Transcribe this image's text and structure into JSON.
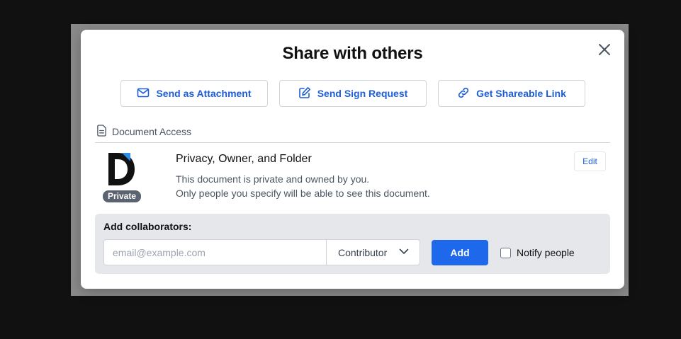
{
  "dialog": {
    "title": "Share with others"
  },
  "actions": {
    "attachment_label": "Send as Attachment",
    "sign_request_label": "Send Sign Request",
    "shareable_link_label": "Get Shareable Link"
  },
  "access": {
    "section_label": "Document Access",
    "badge": "Private",
    "title": "Privacy, Owner, and Folder",
    "description_line1": "This document is private and owned by you.",
    "description_line2": "Only people you specify will be able to see this document.",
    "edit_label": "Edit"
  },
  "collaborators": {
    "label": "Add collaborators:",
    "email_placeholder": "email@example.com",
    "email_value": "",
    "role_selected": "Contributor",
    "add_label": "Add",
    "notify_label": "Notify people",
    "notify_checked": false
  },
  "colors": {
    "accent": "#1d68eb",
    "link_text": "#1d5ed8",
    "badge_bg": "#5b6270",
    "logo_accent": "#2b8ce6"
  },
  "icons": {
    "close": "close-icon",
    "attachment": "envelope-icon",
    "sign_request": "pen-square-icon",
    "shareable_link": "link-icon",
    "section": "document-icon",
    "role_select": "chevron-down-icon"
  }
}
